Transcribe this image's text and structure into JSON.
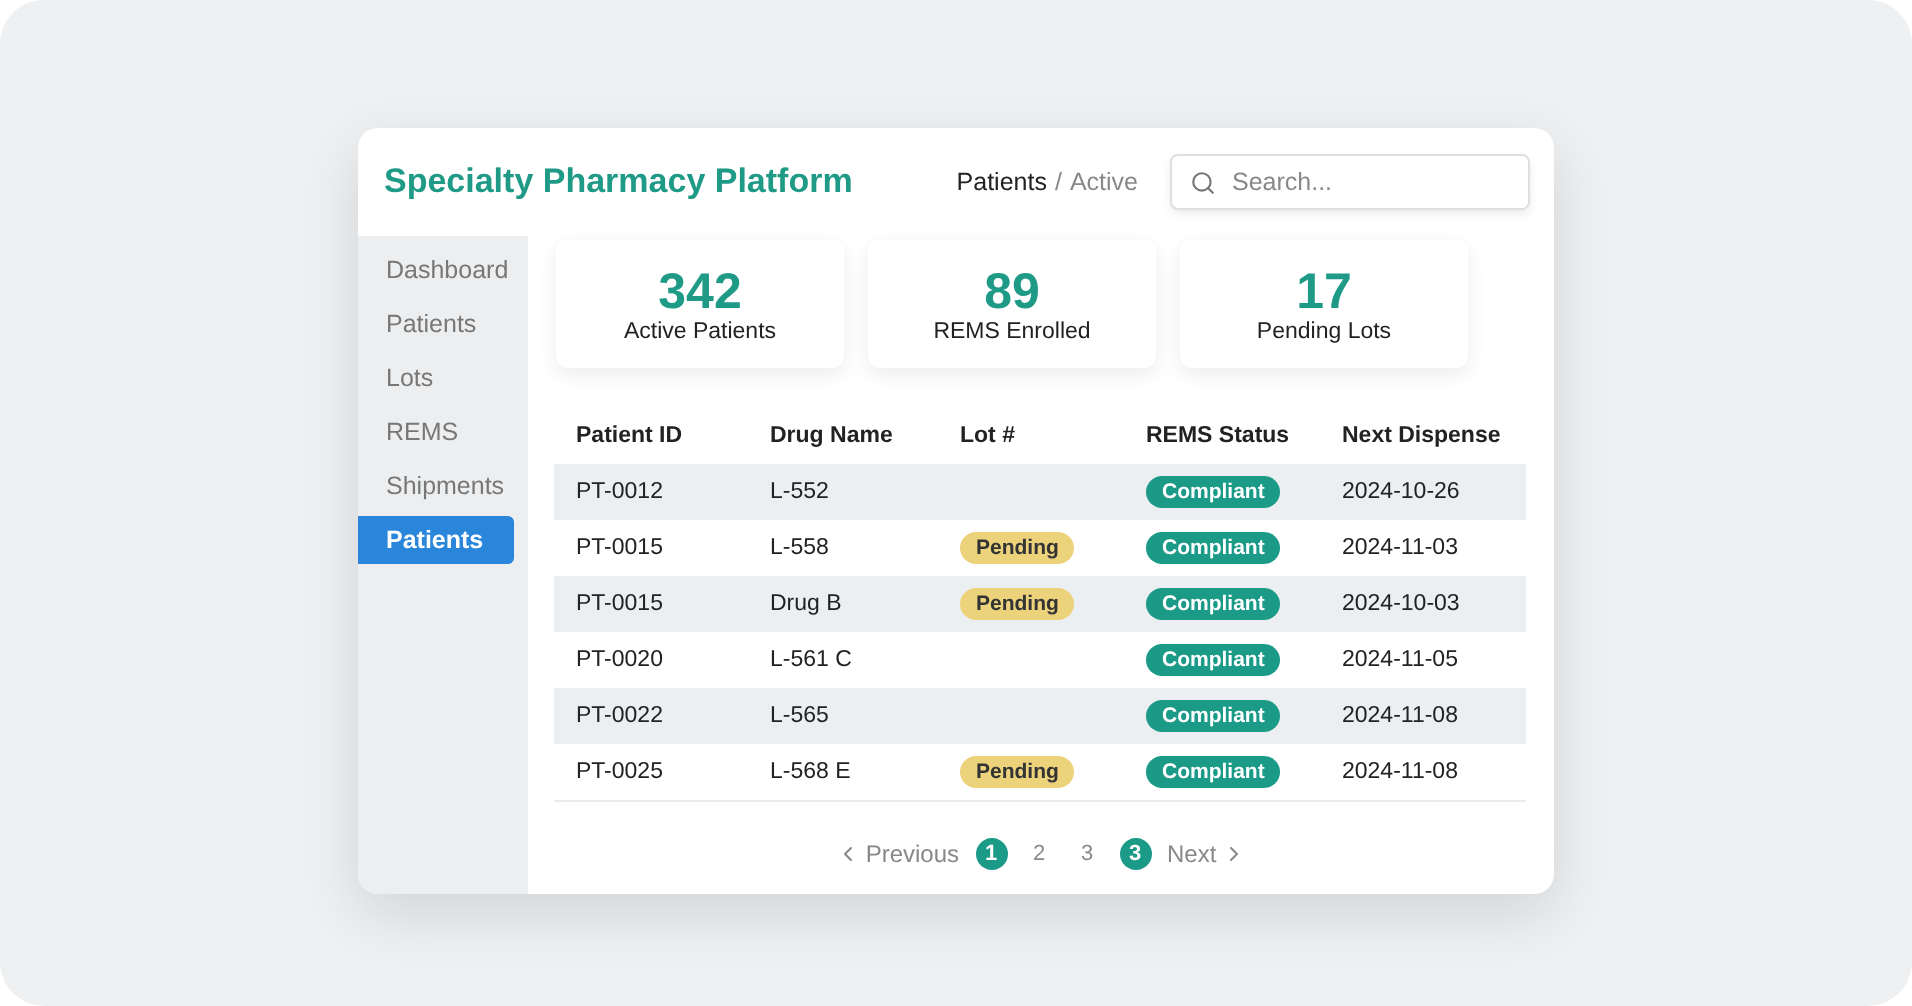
{
  "header": {
    "title": "Specialty Pharmacy Platform",
    "breadcrumb": {
      "current": "Patients",
      "separator": "/",
      "sub": "Active"
    },
    "search": {
      "placeholder": "Search..."
    }
  },
  "sidebar": {
    "items": [
      {
        "label": "Dashboard",
        "selected": false
      },
      {
        "label": "Patients",
        "selected": false
      },
      {
        "label": "Lots",
        "selected": false
      },
      {
        "label": "REMS",
        "selected": false
      },
      {
        "label": "Shipments",
        "selected": false
      },
      {
        "label": "Patients",
        "selected": true
      }
    ]
  },
  "stats": [
    {
      "value": "342",
      "label": "Active Patients"
    },
    {
      "value": "89",
      "label": "REMS Enrolled"
    },
    {
      "value": "17",
      "label": "Pending Lots"
    }
  ],
  "table": {
    "columns": [
      "Patient ID",
      "Drug Name",
      "Lot #",
      "REMS Status",
      "Next Dispense"
    ],
    "rows": [
      {
        "patient_id": "PT-0012",
        "drug": "L-552",
        "rems": "Compliant",
        "next": "2024-10-26"
      },
      {
        "patient_id": "PT-0015",
        "drug": "L-558",
        "lot": "Pending",
        "rems": "Compliant",
        "next": "2024-11-03"
      },
      {
        "patient_id": "PT-0015",
        "drug": "Drug B",
        "lot": "Pending",
        "rems": "Compliant",
        "next": "2024-10-03"
      },
      {
        "patient_id": "PT-0020",
        "drug": "L-561 C",
        "rems": "Compliant",
        "next": "2024-11-05"
      },
      {
        "patient_id": "PT-0022",
        "drug": "L-565",
        "rems": "Compliant",
        "next": "2024-11-08"
      },
      {
        "patient_id": "PT-0025",
        "drug": "L-568 E",
        "lot": "Pending",
        "rems": "Compliant",
        "next": "2024-11-08"
      }
    ]
  },
  "pagination": {
    "previous": "Previous",
    "next": "Next",
    "pages": [
      {
        "label": "1",
        "selected": true
      },
      {
        "label": "2",
        "selected": false
      },
      {
        "label": "3",
        "selected": false
      },
      {
        "label": "3",
        "selected": true
      }
    ]
  }
}
